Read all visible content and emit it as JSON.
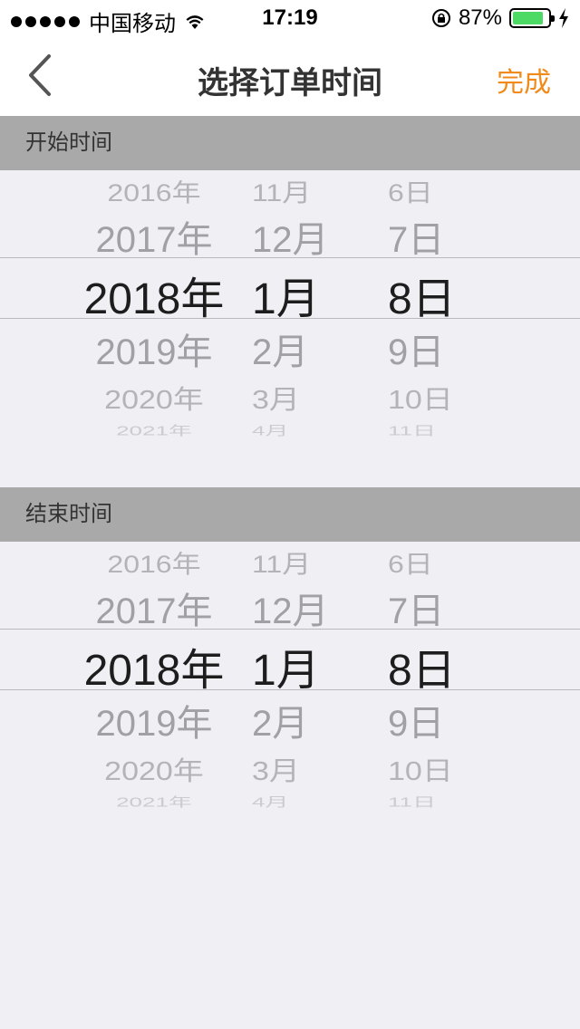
{
  "status_bar": {
    "carrier": "中国移动",
    "time": "17:19",
    "battery_percent": "87%",
    "battery_level": 0.87,
    "battery_color": "#4cd964"
  },
  "nav": {
    "title": "选择订单时间",
    "done_label": "完成",
    "back_icon": "chevron-left-icon",
    "accent_color": "#f08a1a"
  },
  "start": {
    "header": "开始时间",
    "years": [
      "2016年",
      "2017年",
      "2018年",
      "2019年",
      "2020年",
      "2021年"
    ],
    "months": [
      "11月",
      "12月",
      "1月",
      "2月",
      "3月",
      "4月"
    ],
    "days": [
      "6日",
      "7日",
      "8日",
      "9日",
      "10日",
      "11日"
    ],
    "selected": {
      "year": "2018年",
      "month": "1月",
      "day": "8日"
    }
  },
  "end": {
    "header": "结束时间",
    "years": [
      "2016年",
      "2017年",
      "2018年",
      "2019年",
      "2020年",
      "2021年"
    ],
    "months": [
      "11月",
      "12月",
      "1月",
      "2月",
      "3月",
      "4月"
    ],
    "days": [
      "6日",
      "7日",
      "8日",
      "9日",
      "10日",
      "11日"
    ],
    "selected": {
      "year": "2018年",
      "month": "1月",
      "day": "8日"
    }
  }
}
